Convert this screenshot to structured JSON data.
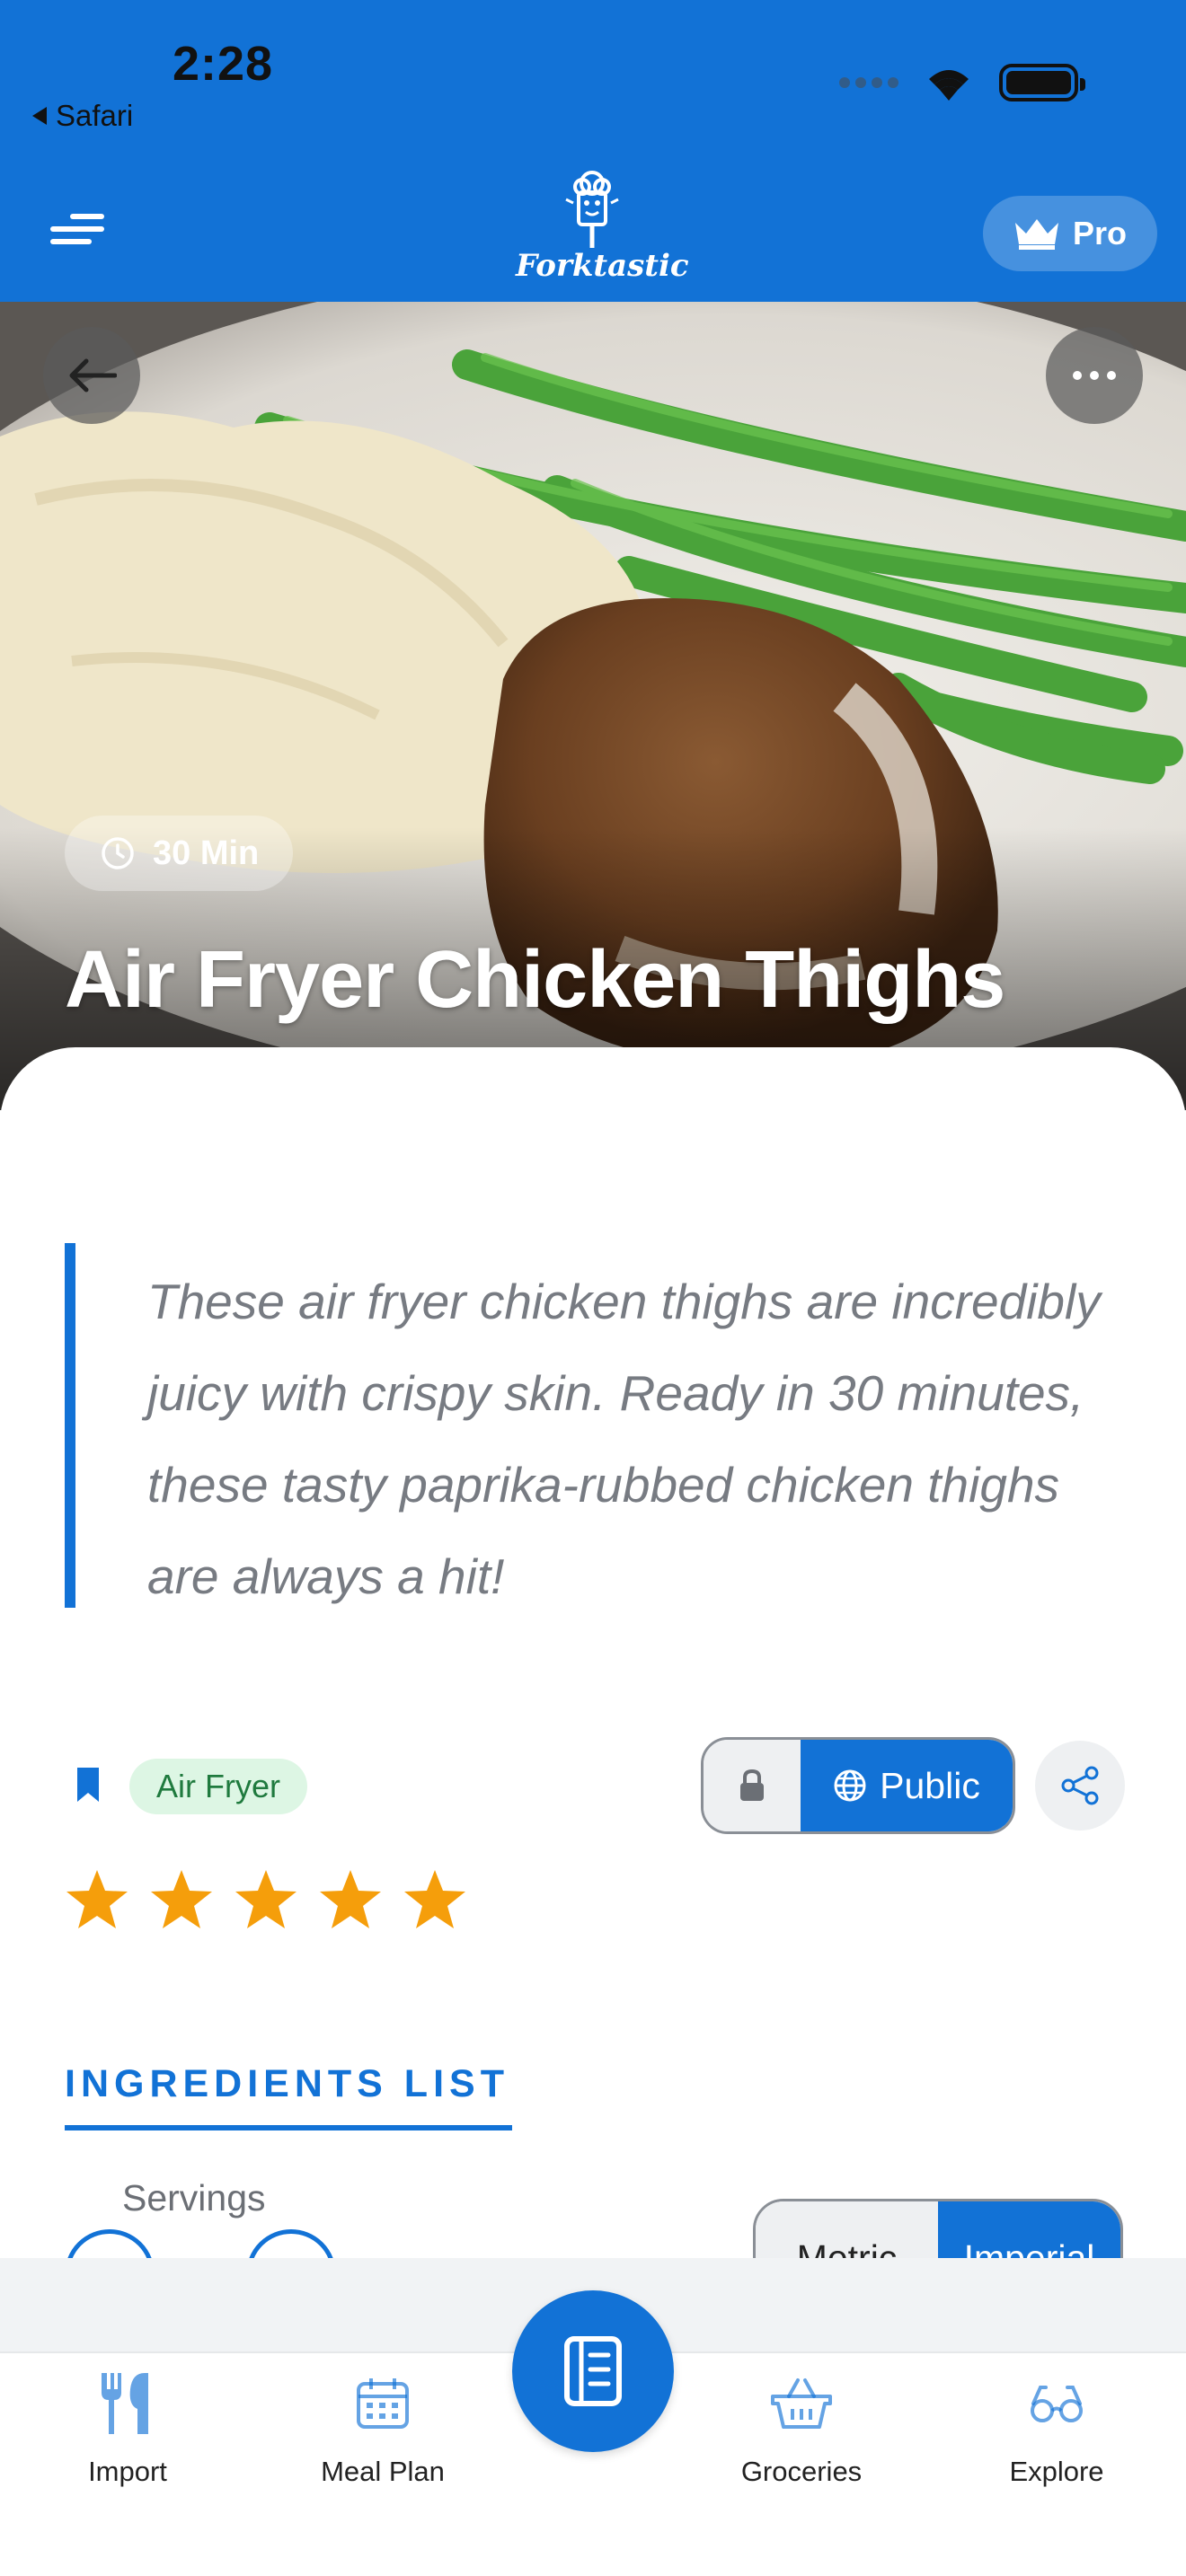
{
  "status_bar": {
    "time": "2:28",
    "back_app": "Safari"
  },
  "header": {
    "logo_text": "Forktastic",
    "pro_label": "Pro"
  },
  "recipe": {
    "time_badge": "30 Min",
    "title": "Air Fryer Chicken Thighs",
    "description": "These air fryer chicken thighs are incredibly juicy with crispy skin. Ready in 30 minutes, these tasty paprika-rubbed chicken thighs are always a hit!",
    "tag": "Air Fryer",
    "visibility": "Public",
    "rating": 5,
    "rating_max": 5
  },
  "ingredients": {
    "section_title": "INGREDIENTS LIST",
    "servings_label": "Servings",
    "units": [
      "Metric",
      "Imperial"
    ],
    "selected_unit": "Imperial"
  },
  "tabbar": {
    "items": [
      {
        "label": "Import",
        "icon": "fork-knife-icon"
      },
      {
        "label": "Meal Plan",
        "icon": "calendar-icon"
      },
      {
        "label": "",
        "icon": "recipe-book-icon"
      },
      {
        "label": "Groceries",
        "icon": "basket-icon"
      },
      {
        "label": "Explore",
        "icon": "glasses-icon"
      }
    ]
  },
  "colors": {
    "brand_blue": "#1272d6",
    "tag_green_bg": "#ddf6e4",
    "tag_green_text": "#1f7a3e",
    "star": "#f59e0b"
  }
}
